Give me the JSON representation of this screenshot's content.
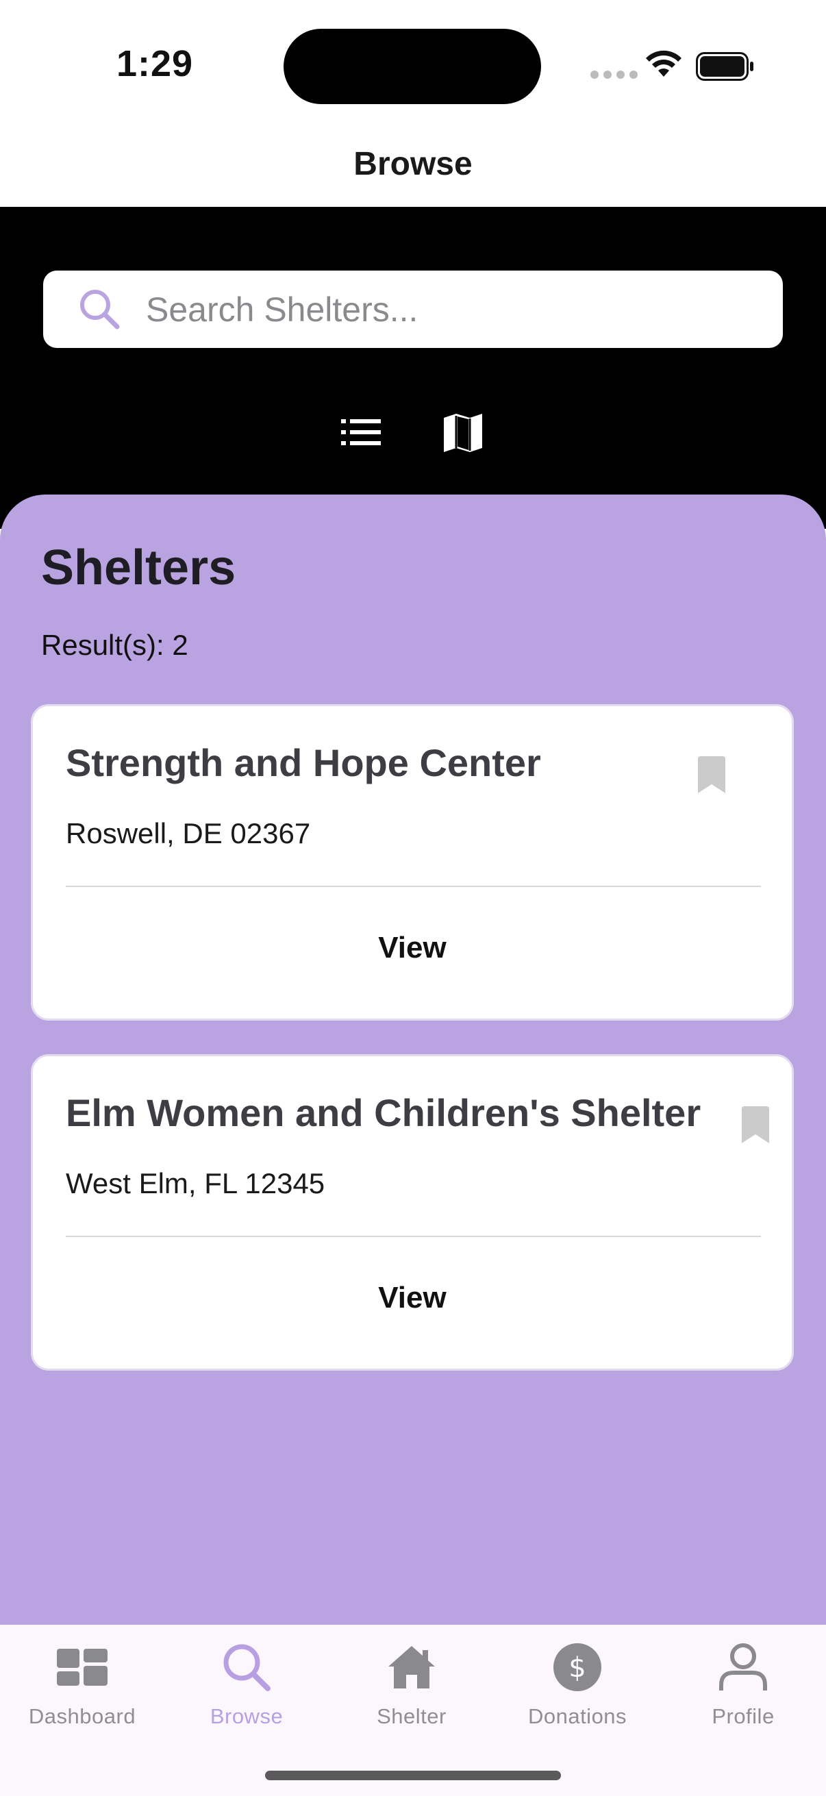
{
  "status": {
    "time": "1:29"
  },
  "nav": {
    "title": "Browse"
  },
  "search": {
    "placeholder": "Search Shelters..."
  },
  "section": {
    "title": "Shelters",
    "result_count": "Result(s): 2"
  },
  "shelters": [
    {
      "name": "Strength and Hope Center",
      "address": "Roswell, DE 02367",
      "action": "View"
    },
    {
      "name": "Elm Women and Children's Shelter",
      "address": "West Elm, FL 12345",
      "action": "View"
    }
  ],
  "tabs": [
    {
      "label": "Dashboard",
      "icon": "dashboard-icon"
    },
    {
      "label": "Browse",
      "icon": "search-icon",
      "active": true
    },
    {
      "label": "Shelter",
      "icon": "house-icon"
    },
    {
      "label": "Donations",
      "icon": "dollar-icon"
    },
    {
      "label": "Profile",
      "icon": "person-icon"
    }
  ],
  "colors": {
    "accent": "#b9a3e0",
    "active_tab": "#b79fe2",
    "header_bg": "#000000"
  }
}
